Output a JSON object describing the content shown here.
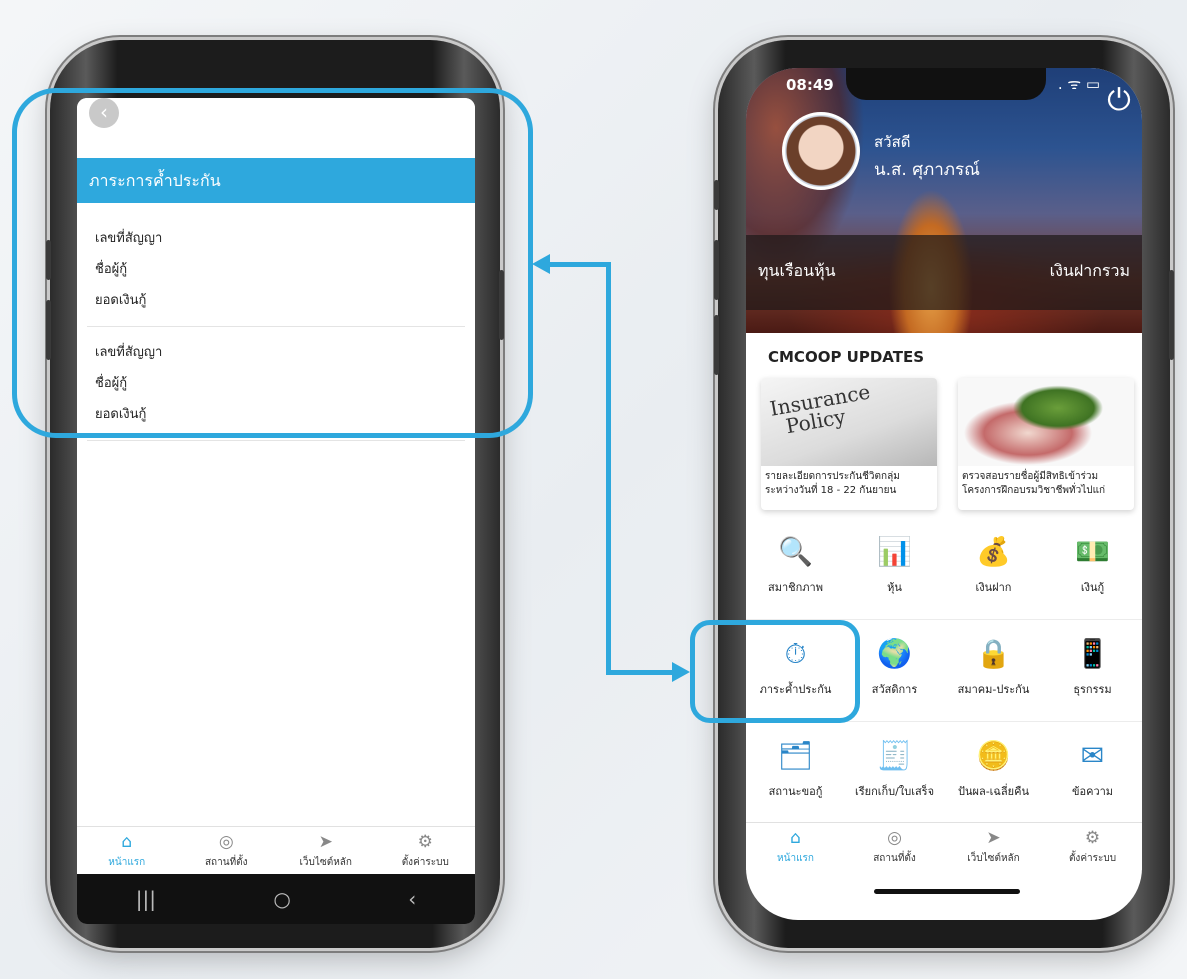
{
  "left_screen": {
    "title": "ภาระการค้ำประกัน",
    "back_label": "‹",
    "contracts": [
      {
        "contract_no_label": "เลขที่สัญญา",
        "borrower_label": "ชื่อผู้กู้",
        "amount_label": "ยอดเงินกู้"
      },
      {
        "contract_no_label": "เลขที่สัญญา",
        "borrower_label": "ชื่อผู้กู้",
        "amount_label": "ยอดเงินกู้"
      }
    ],
    "tabbar": [
      {
        "label": "หน้าแรก",
        "icon": "home-icon",
        "glyph": "⌂"
      },
      {
        "label": "สถานที่ตั้ง",
        "icon": "compass-icon",
        "glyph": "◎"
      },
      {
        "label": "เว็บไซต์หลัก",
        "icon": "navigation-icon",
        "glyph": "➤"
      },
      {
        "label": "ตั้งค่าระบบ",
        "icon": "gear-icon",
        "glyph": "⚙"
      }
    ],
    "android_nav": {
      "recents": "|||",
      "home": "○",
      "back": "‹"
    }
  },
  "right_screen": {
    "status_time": "08:49",
    "status_right": ". ᯤ ▭",
    "power_glyph": "⏻",
    "greeting": "สวัสดี",
    "user_name": "น.ส. ศุภาภรณ์",
    "balance_left": "ทุนเรือนหุ้น",
    "balance_right": "เงินฝากรวม",
    "updates_title": "CMCOOP UPDATES",
    "cards": [
      {
        "image_text_1": "Insurance",
        "image_text_2": "Policy",
        "caption": "รายละเอียดการประกันชีวิตกลุ่ม ระหว่างวันที่ 18 - 22 กันยายน"
      },
      {
        "caption": "ตรวจสอบรายชื่อผู้มีสิทธิเข้าร่วม โครงการฝึกอบรมวิชาชีพทั่วไปแก่"
      }
    ],
    "menu_rows": [
      [
        {
          "label": "สมาชิกภาพ",
          "icon": "membership-search-icon",
          "glyph": "🔍"
        },
        {
          "label": "หุ้น",
          "icon": "shares-chart-icon",
          "glyph": "📊"
        },
        {
          "label": "เงินฝาก",
          "icon": "deposit-moneybag-icon",
          "glyph": "💰"
        },
        {
          "label": "เงินกู้",
          "icon": "loan-hand-icon",
          "glyph": "💵"
        }
      ],
      [
        {
          "label": "ภาระค้ำประกัน",
          "icon": "guarantee-stopwatch-icon",
          "glyph": "⏱"
        },
        {
          "label": "สวัสดิการ",
          "icon": "welfare-globe-icon",
          "glyph": "🌍"
        },
        {
          "label": "สมาคม-ประกัน",
          "icon": "association-lock-icon",
          "glyph": "🔒"
        },
        {
          "label": "ธุรกรรม",
          "icon": "transaction-phone-icon",
          "glyph": "📱"
        }
      ],
      [
        {
          "label": "สถานะขอกู้",
          "icon": "loan-status-icon",
          "glyph": "🗂"
        },
        {
          "label": "เรียกเก็บ/ใบเสร็จ",
          "icon": "billing-receipt-icon",
          "glyph": "🧾"
        },
        {
          "label": "ปันผล-เฉลี่ยคืน",
          "icon": "dividend-coins-icon",
          "glyph": "🪙"
        },
        {
          "label": "ข้อความ",
          "icon": "message-envelope-icon",
          "glyph": "✉"
        }
      ]
    ],
    "tabbar": [
      {
        "label": "หน้าแรก",
        "icon": "home-icon",
        "glyph": "⌂"
      },
      {
        "label": "สถานที่ตั้ง",
        "icon": "compass-icon",
        "glyph": "◎"
      },
      {
        "label": "เว็บไซต์หลัก",
        "icon": "navigation-icon",
        "glyph": "➤"
      },
      {
        "label": "ตั้งค่าระบบ",
        "icon": "gear-icon",
        "glyph": "⚙"
      }
    ]
  },
  "colors": {
    "accent": "#2ea8dd",
    "icon_blue": "#2a86c8"
  }
}
